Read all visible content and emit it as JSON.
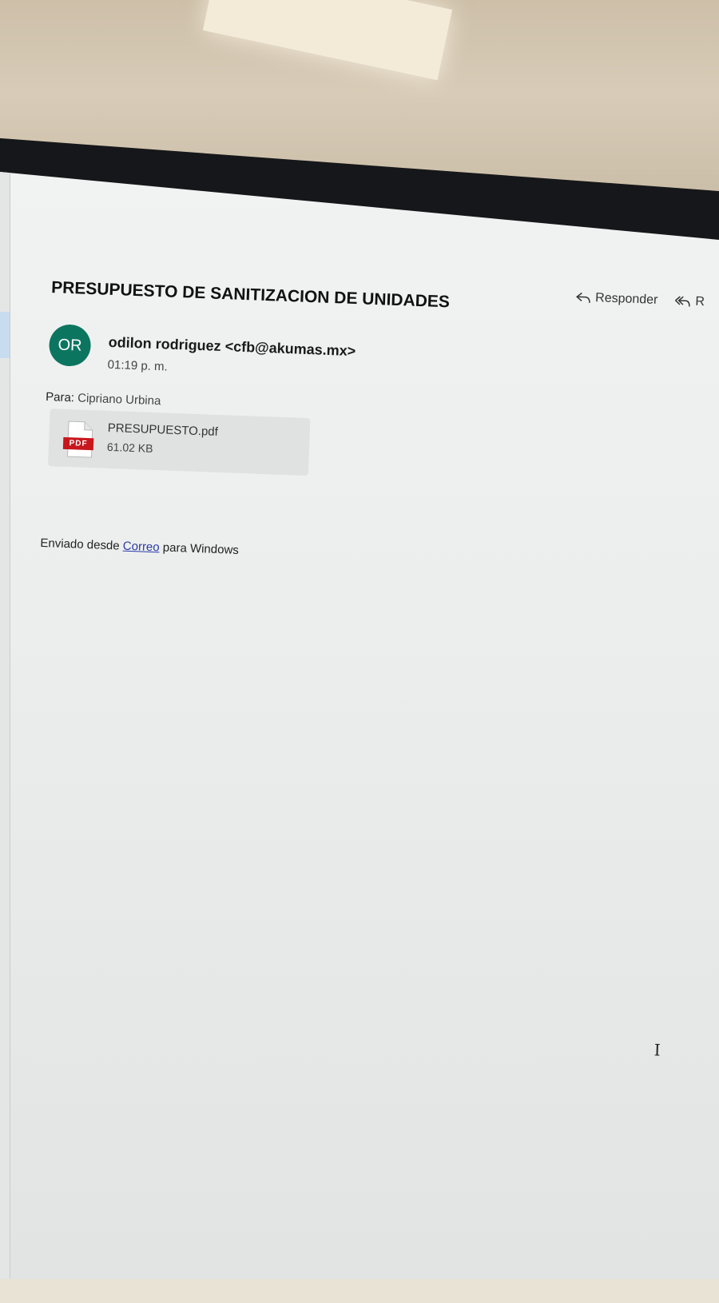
{
  "email": {
    "subject": "PRESUPUESTO DE SANITIZACION DE UNIDADES",
    "actions": [
      {
        "label": "Responder",
        "icon": "reply-icon"
      },
      {
        "label": "R",
        "icon": "reply-all-icon"
      }
    ],
    "sender": {
      "initials": "OR",
      "name": "odilon rodriguez",
      "address": "<cfb@akumas.mx>",
      "avatar_color": "#0c7560"
    },
    "time": "01:19 p. m.",
    "to": {
      "label": "Para:",
      "value": "Cipriano Urbina"
    },
    "attachment": {
      "icon": "pdf-file-icon",
      "badge": "PDF",
      "filename": "PRESUPUESTO.pdf",
      "size": "61.02 KB"
    },
    "signature": {
      "prefix": "Enviado desde",
      "link": "Correo",
      "suffix": "para Windows",
      "link_color": "#2b3aa8"
    }
  }
}
